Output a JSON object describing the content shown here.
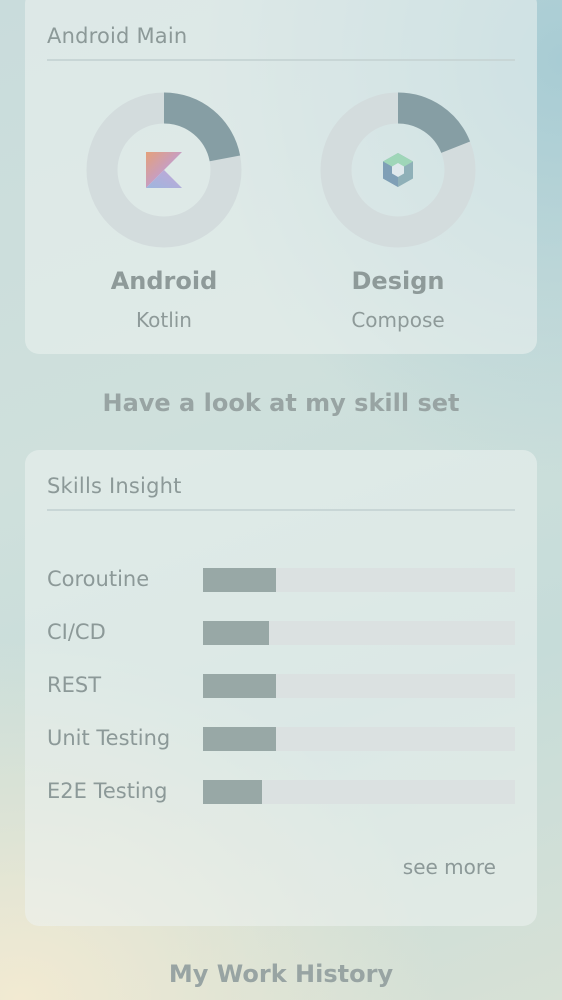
{
  "android_card": {
    "title": "Android Main",
    "items": [
      {
        "name": "Android",
        "subtitle": "Kotlin",
        "progress": 0.22,
        "icon": "kotlin-logo-icon"
      },
      {
        "name": "Design",
        "subtitle": "Compose",
        "progress": 0.19,
        "icon": "compose-logo-icon"
      }
    ]
  },
  "skill_set_heading": "Have a look at my skill set",
  "skills_card": {
    "title": "Skills Insight",
    "skills": [
      {
        "label": "Coroutine",
        "level": 0.235
      },
      {
        "label": "CI/CD",
        "level": 0.21
      },
      {
        "label": "REST",
        "level": 0.235
      },
      {
        "label": "Unit Testing",
        "level": 0.235
      },
      {
        "label": "E2E Testing",
        "level": 0.19
      }
    ],
    "see_more_label": "see more"
  },
  "work_history_heading": "My Work History",
  "colors": {
    "donut_track": "#d3dcdd",
    "donut_fill": "#869ea4",
    "bar_fill": "#98a8a6",
    "text_muted": "#8c9998"
  }
}
